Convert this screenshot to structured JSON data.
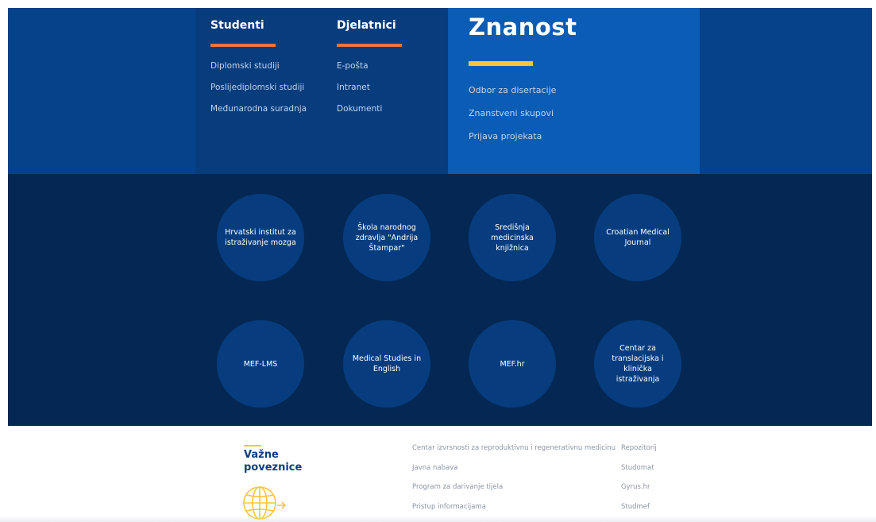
{
  "menu": {
    "studenti": {
      "title": "Studenti",
      "links": [
        "Diplomski studiji",
        "Poslijediplomski studiji",
        "Međunarodna suradnja"
      ]
    },
    "djelatnici": {
      "title": "Djelatnici",
      "links": [
        "E-pošta",
        "Intranet",
        "Dokumenti"
      ]
    },
    "znanost": {
      "title": "Znanost",
      "links": [
        "Odbor za disertacije",
        "Znanstveni skupovi",
        "Prijava projekata"
      ]
    }
  },
  "circles": [
    "Hrvatski institut za istraživanje mozga",
    "Škola narodnog zdravlja \"Andrija Štampar\"",
    "Središnja medicinska knjižnica",
    "Croatian Medical Journal",
    "MEF-LMS",
    "Medical Studies in English",
    "MEF.hr",
    "Centar za translacijska i klinička istraživanja"
  ],
  "important_links": {
    "title": "Važne poveznice",
    "icon": "globe-icon",
    "column1": [
      "Centar izvrsnosti za reproduktivnu i regenerativnu medicinu",
      "Javna nabava",
      "Program za darivanje tijela",
      "Pristup informacijama"
    ],
    "column2": [
      "Repozitorij",
      "Studomat",
      "Gyrus.hr",
      "Studmef"
    ]
  },
  "colors": {
    "top_band": "#05428a",
    "column_dark": "#073c7d",
    "znanost_panel": "#0a5cb4",
    "circles_band": "#042853",
    "circle_fill": "#073d7f",
    "orange_accent": "#f2753a",
    "yellow_accent": "#f8c63c",
    "title_blue": "#0a3e80"
  }
}
